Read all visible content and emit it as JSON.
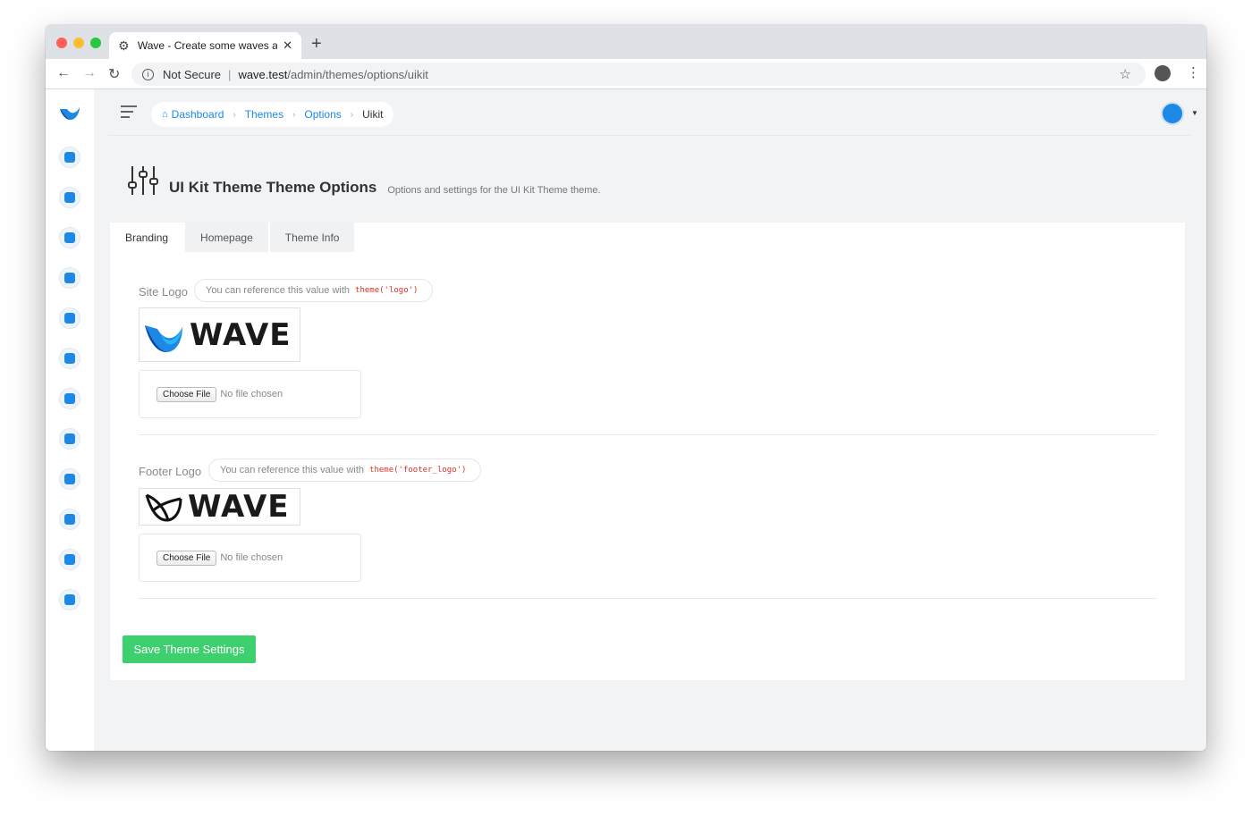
{
  "browser": {
    "tab_title": "Wave - Create some waves and",
    "not_secure": "Not Secure",
    "url_host": "wave.test",
    "url_path": "/admin/themes/options/uikit"
  },
  "breadcrumb": {
    "items": [
      "Dashboard",
      "Themes",
      "Options"
    ],
    "current": "Uikit"
  },
  "page": {
    "title": "UI Kit Theme Theme Options",
    "subtitle": "Options and settings for the UI Kit Theme theme."
  },
  "tabs": [
    "Branding",
    "Homepage",
    "Theme Info"
  ],
  "fields": [
    {
      "label": "Site Logo",
      "ref_text": "You can reference this value with",
      "ref_code": "theme('logo')",
      "logo_text": "WAVE",
      "file_button": "Choose File",
      "file_status": "No file chosen"
    },
    {
      "label": "Footer Logo",
      "ref_text": "You can reference this value with",
      "ref_code": "theme('footer_logo')",
      "logo_text": "WAVE",
      "file_button": "Choose File",
      "file_status": "No file chosen"
    }
  ],
  "save_button": "Save Theme Settings",
  "sidebar_icons": [
    "dashboard-icon",
    "themes-icon",
    "roles-icon",
    "users-icon",
    "media-icon",
    "posts-icon",
    "pages-icon",
    "categories-icon",
    "announcements-icon",
    "tools-icon",
    "settings-icon",
    "plans-icon"
  ],
  "colors": {
    "accent": "#1e88e5",
    "save": "#3ecf6f",
    "code": "#d93025"
  }
}
